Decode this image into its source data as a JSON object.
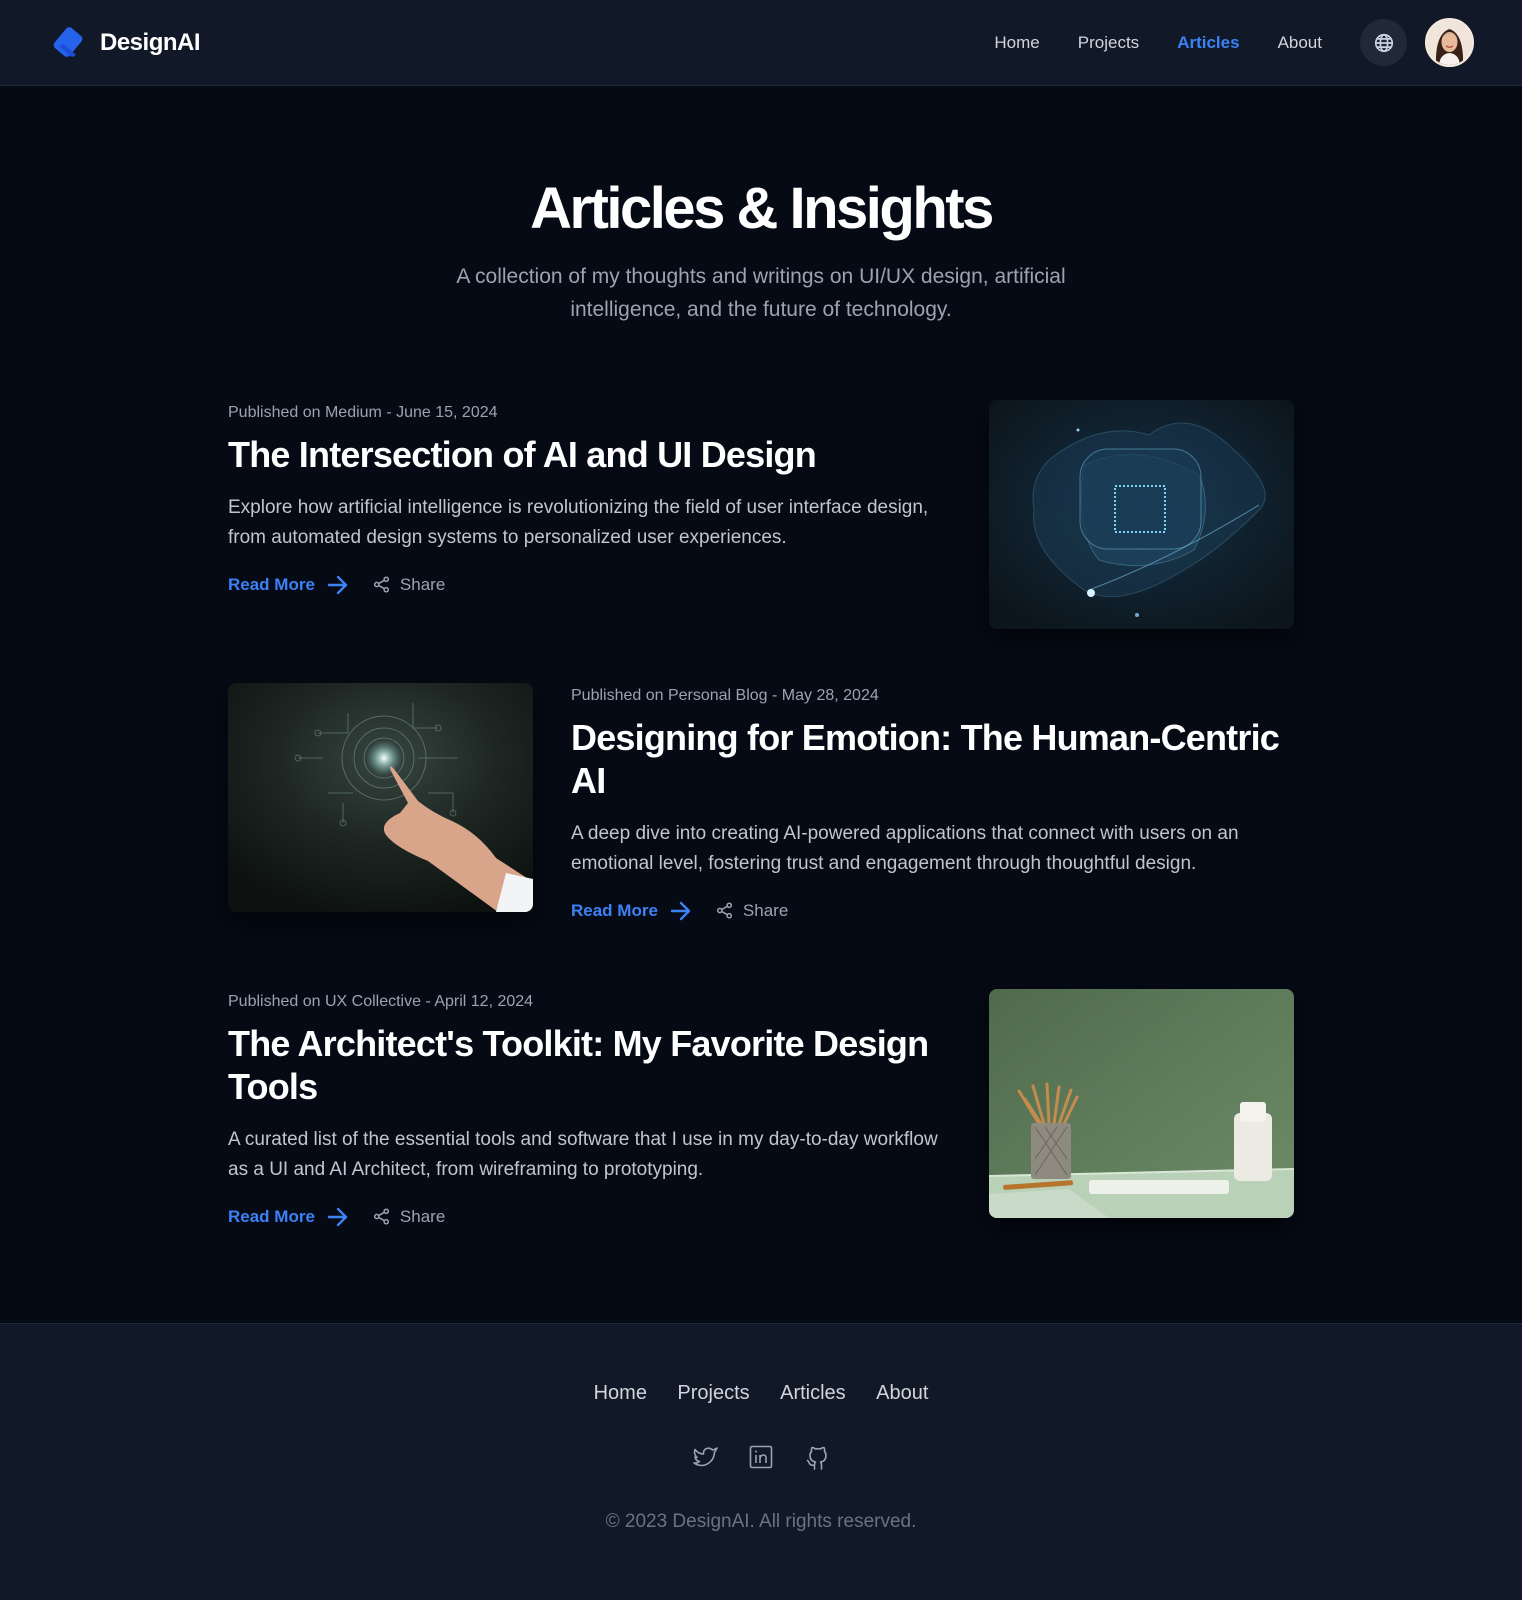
{
  "brand": {
    "name": "DesignAI",
    "logo_icon": "design-logo-icon"
  },
  "nav": {
    "items": [
      {
        "label": "Home",
        "active": false
      },
      {
        "label": "Projects",
        "active": false
      },
      {
        "label": "Articles",
        "active": true
      },
      {
        "label": "About",
        "active": false
      }
    ],
    "language_icon": "globe-icon",
    "avatar_icon": "user-avatar"
  },
  "hero": {
    "title": "Articles & Insights",
    "subtitle": "A collection of my thoughts and writings on UI/UX design, artificial intelligence, and the future of technology."
  },
  "articles": [
    {
      "meta": "Published on Medium - June 15, 2024",
      "title": "The Intersection of AI and UI Design",
      "description": "Explore how artificial intelligence is revolutionizing the field of user interface design, from automated design systems to personalized user experiences.",
      "read_more": "Read More",
      "share": "Share"
    },
    {
      "meta": "Published on Personal Blog - May 28, 2024",
      "title": "Designing for Emotion: The Human-Centric AI",
      "description": "A deep dive into creating AI-powered applications that connect with users on an emotional level, fostering trust and engagement through thoughtful design.",
      "read_more": "Read More",
      "share": "Share"
    },
    {
      "meta": "Published on UX Collective - April 12, 2024",
      "title": "The Architect's Toolkit: My Favorite Design Tools",
      "description": "A curated list of the essential tools and software that I use in my day-to-day workflow as a UI and AI Architect, from wireframing to prototyping.",
      "read_more": "Read More",
      "share": "Share"
    }
  ],
  "footer": {
    "links": [
      "Home",
      "Projects",
      "Articles",
      "About"
    ],
    "social_icons": [
      "twitter-icon",
      "linkedin-icon",
      "github-icon"
    ],
    "copyright": "© 2023 DesignAI. All rights reserved."
  },
  "colors": {
    "background": "#050a15",
    "surface": "#111827",
    "accent": "#3b82f6",
    "text": "#ffffff",
    "muted": "#9ca3af"
  }
}
